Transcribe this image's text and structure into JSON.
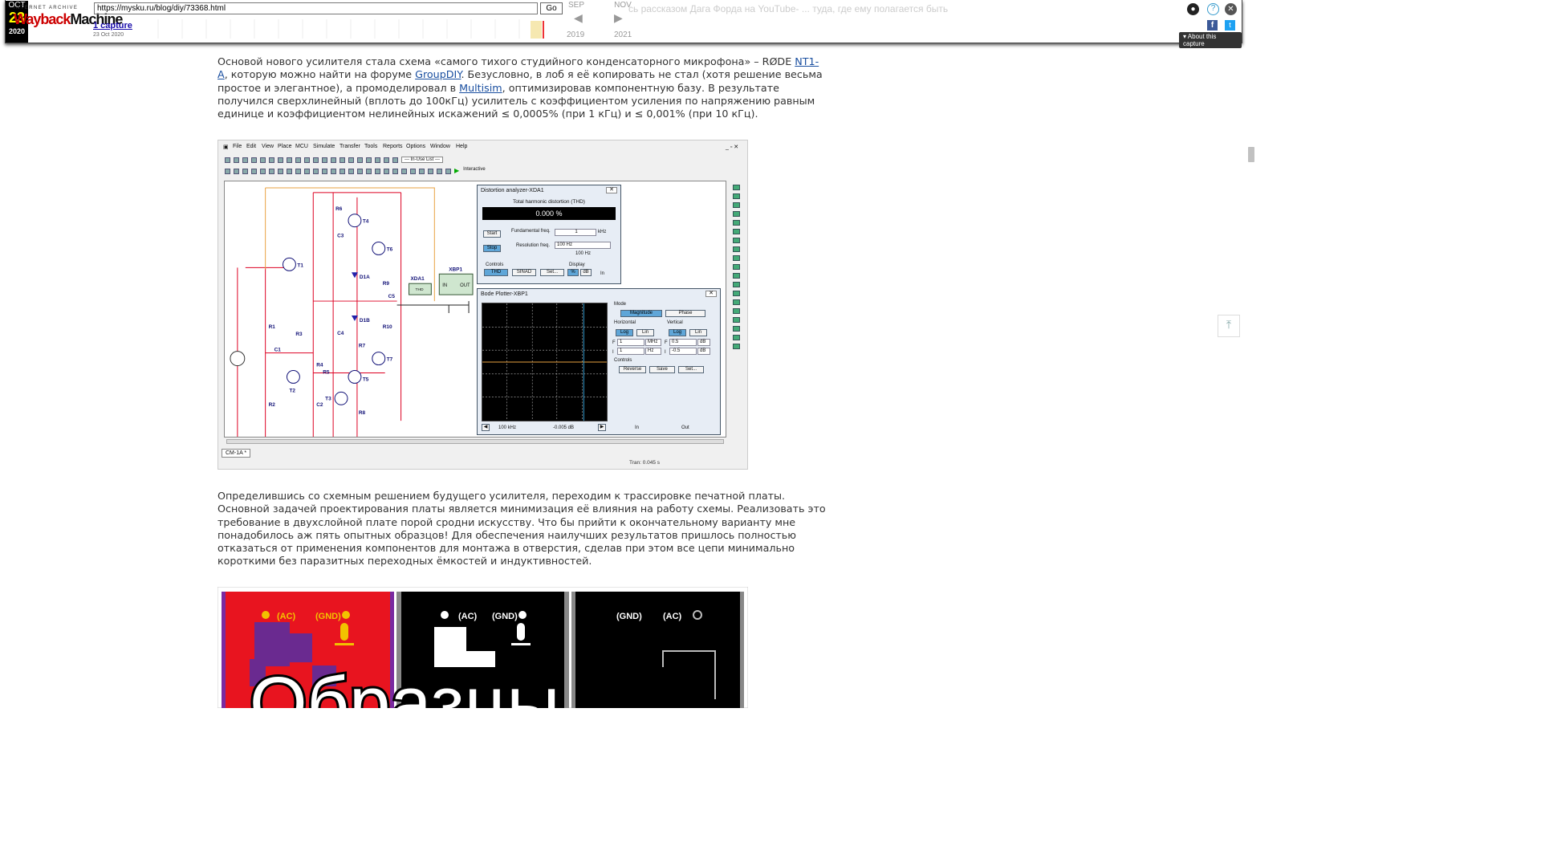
{
  "wayback": {
    "logo_top": "INTERNET ARCHIVE",
    "logo_wayback": "Wayback",
    "logo_machine": "Machine",
    "url": "https://mysku.ru/blog/diy/73368.html",
    "go_label": "Go",
    "captures_label": "1 capture",
    "capture_date": "23 Oct 2020",
    "prev_month": "SEP",
    "cur_month": "OCT",
    "cur_day": "23",
    "cur_year": "2020",
    "next_month": "NOV",
    "prev_year": "2019",
    "next_year": "2021",
    "about_label": "About this capture",
    "ghost_text": "сь рассказом Дага Форда на YouTube- ... туда, где ему полагается быть",
    "icons": [
      "user-icon",
      "help-icon",
      "close-icon",
      "facebook-icon",
      "twitter-icon"
    ]
  },
  "article": {
    "para1": {
      "t1": "Основой нового усилителя стала схема «самого тихого студийного конденсаторного микрофона» – RØDE ",
      "link1": "NT1-A",
      "t2": ", которую можно найти на форуме ",
      "link2": "GroupDIY",
      "t3": ". Безусловно, в лоб я её копировать не стал (хотя решение весьма простое и элегантное), а промоделировал в ",
      "link3": "Multisim",
      "t4": ", оптимизировав компонентную базу. В результате получился сверхлинейный (вплоть до 100кГц) усилитель с коэффициентом усиления по напряжению равным единице и коэффициентом нелинейных искажений ≤ 0,0005% (при 1 кГц) и ≤ 0,001% (при 10 кГц)."
    },
    "para2": "Определившись со схемным решением будущего усилителя, переходим к трассировке печатной платы. Основной задачей проектирования платы является минимизация её влияния на работу схемы. Реализовать это требование в двухслойной плате порой сродни искусству. Что бы прийти к окончательному варианту мне понадобилось аж пять опытных образцов! Для обеспечения наилучших результатов пришлось полностью отказаться от применения компонентов для монтажа в отверстия, сделав при этом все цепи минимально короткими без паразитных переходных ёмкостей и индуктивностей."
  },
  "multisim": {
    "menu": [
      "File",
      "Edit",
      "View",
      "Place",
      "MCU",
      "Simulate",
      "Transfer",
      "Tools",
      "Reports",
      "Options",
      "Window",
      "Help"
    ],
    "inuse_list": "--- In-Use List ---",
    "interactive_label": "Interactive",
    "tab_label": "CM-1A *",
    "status": "Tran: 0.045 s",
    "components": [
      "R6",
      "T4",
      "C3",
      "T6",
      "T1",
      "D1A",
      "R9",
      "XDA1",
      "XBP1",
      "C5",
      "D1B",
      "R1",
      "R3",
      "C4",
      "R10",
      "R7",
      "C1",
      "T7",
      "R4",
      "R5",
      "T2",
      "T5",
      "T3",
      "R2",
      "C2",
      "R8"
    ],
    "xbp1_in": "IN",
    "xbp1_out": "OUT",
    "xda1_thd": "THD",
    "distortion": {
      "title": "Distortion analyzer-XDA1",
      "thd_label": "Total harmonic distortion (THD)",
      "readout": "0.000 %",
      "start": "Start",
      "stop": "Stop",
      "fund_label": "Fundamental freq.",
      "fund_value": "1",
      "fund_unit": "kHz",
      "res_label": "Resolution freq.",
      "res_value": "100 Hz",
      "res_sub": "100 Hz",
      "controls_label": "Controls",
      "thd_btn": "THD",
      "sinad_btn": "SINAD",
      "set_btn": "Set...",
      "display_label": "Display",
      "pct_btn": "%",
      "db_btn": "dB",
      "in_label": "In"
    },
    "bode": {
      "title": "Bode Plotter-XBP1",
      "mode_label": "Mode",
      "magnitude": "Magnitude",
      "phase": "Phase",
      "horizontal": "Horizontal",
      "vertical": "Vertical",
      "log": "Log",
      "lin": "Lin",
      "h_f_value": "1",
      "h_f_unit": "MHz",
      "h_i_value": "1",
      "h_i_unit": "Hz",
      "v_f_value": "0.5",
      "v_f_unit": "dB",
      "v_i_value": "-0.5",
      "v_i_unit": "dB",
      "f_label": "F",
      "i_label": "I",
      "controls_label": "Controls",
      "reverse": "Reverse",
      "save": "Save",
      "set": "Set...",
      "readout_freq": "100 kHz",
      "readout_db": "-0.005 dB",
      "in_label": "In",
      "out_label": "Out"
    }
  },
  "pcb": {
    "labels": [
      "(AC)",
      "(GND)",
      "(AC)",
      "(GND)",
      "(GND)",
      "(AC)"
    ],
    "overlay_text": "Образцы",
    "colors": {
      "red": "#e8141f",
      "black": "#000000",
      "purple": "#6a2a90",
      "yellow": "#f2c200"
    }
  }
}
